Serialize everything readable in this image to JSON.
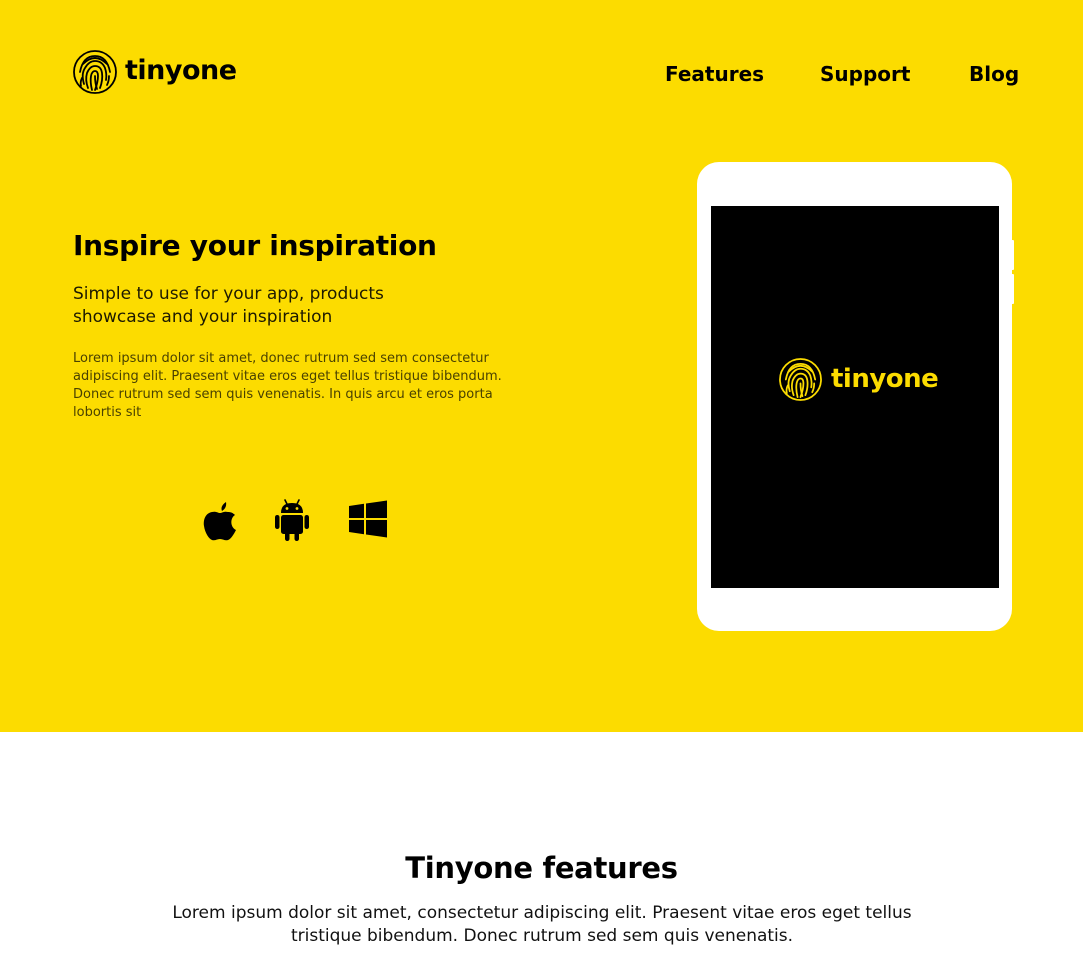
{
  "brand": {
    "name": "tinyone",
    "logo_icon": "fingerprint-icon",
    "color_primary": "#fcdc00",
    "color_dark": "#000000"
  },
  "nav": {
    "items": [
      {
        "label": "Features"
      },
      {
        "label": "Support"
      },
      {
        "label": "Blog"
      }
    ]
  },
  "hero": {
    "title": "Inspire your inspiration",
    "subtitle": "Simple to use for your app, products showcase and your inspiration",
    "body": "Lorem ipsum dolor sit amet, donec rutrum sed sem consectetur adipiscing elit. Praesent vitae eros eget tellus tristique bibendum. Donec rutrum sed sem quis venenatis. In quis arcu et eros porta lobortis sit",
    "platforms": [
      {
        "icon": "apple-icon"
      },
      {
        "icon": "android-icon"
      },
      {
        "icon": "windows-icon"
      }
    ],
    "device": {
      "screen_logo_text": "tinyone",
      "screen_color": "#000000",
      "frame_color": "#ffffff"
    }
  },
  "features": {
    "title": "Tinyone features",
    "body": "Lorem ipsum dolor sit amet, consectetur adipiscing elit. Praesent vitae eros eget tellus tristique bibendum. Donec rutrum sed sem quis venenatis."
  }
}
